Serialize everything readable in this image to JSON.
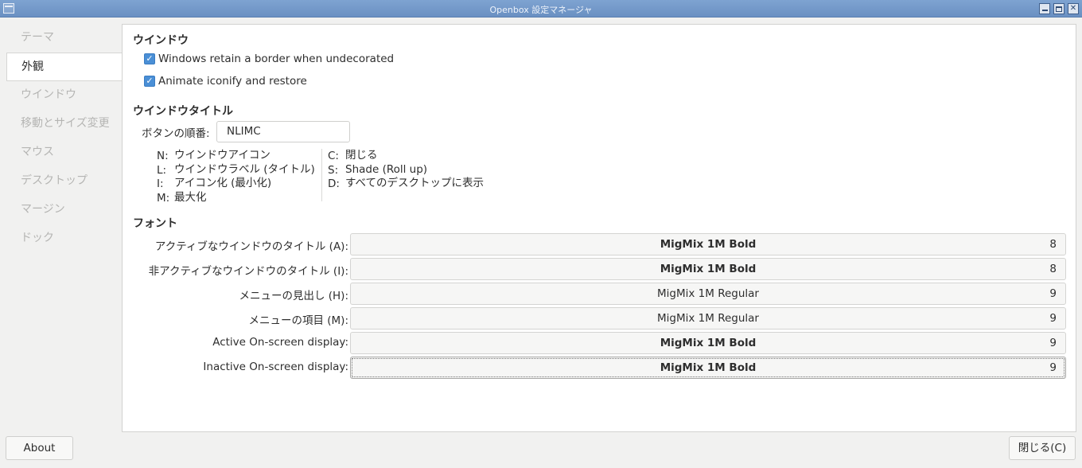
{
  "window": {
    "title": "Openbox 設定マネージャ"
  },
  "sidebar": {
    "items": [
      {
        "label": "テーマ",
        "active": false
      },
      {
        "label": "外観",
        "active": true
      },
      {
        "label": "ウインドウ",
        "active": false
      },
      {
        "label": "移動とサイズ変更",
        "active": false
      },
      {
        "label": "マウス",
        "active": false
      },
      {
        "label": "デスクトップ",
        "active": false
      },
      {
        "label": "マージン",
        "active": false
      },
      {
        "label": "ドック",
        "active": false
      }
    ]
  },
  "window_section": {
    "title": "ウインドウ",
    "options": [
      {
        "label": "Windows retain a border when undecorated",
        "checked": true
      },
      {
        "label": "Animate iconify and restore",
        "checked": true
      }
    ]
  },
  "titlebar_section": {
    "title": "ウインドウタイトル",
    "button_order_label": "ボタンの順番:",
    "button_order_value": "NLIMC",
    "legend_left": [
      {
        "key": "N:",
        "desc": "ウインドウアイコン"
      },
      {
        "key": "L:",
        "desc": "ウインドウラベル (タイトル)"
      },
      {
        "key": "I:",
        "desc": "アイコン化 (最小化)"
      },
      {
        "key": "M:",
        "desc": "最大化"
      }
    ],
    "legend_right": [
      {
        "key": "C:",
        "desc": "閉じる"
      },
      {
        "key": "S:",
        "desc": "Shade (Roll up)"
      },
      {
        "key": "D:",
        "desc": "すべてのデスクトップに表示"
      }
    ]
  },
  "font_section": {
    "title": "フォント",
    "rows": [
      {
        "label": "アクティブなウインドウのタイトル (A):",
        "font": "MigMix 1M Bold",
        "size": "8",
        "bold": true
      },
      {
        "label": "非アクティブなウインドウのタイトル (I):",
        "font": "MigMix 1M Bold",
        "size": "8",
        "bold": true
      },
      {
        "label": "メニューの見出し (H):",
        "font": "MigMix 1M Regular",
        "size": "9",
        "bold": false
      },
      {
        "label": "メニューの項目 (M):",
        "font": "MigMix 1M Regular",
        "size": "9",
        "bold": false
      },
      {
        "label": "Active On-screen display:",
        "font": "MigMix 1M Bold",
        "size": "9",
        "bold": true
      },
      {
        "label": "Inactive On-screen display:",
        "font": "MigMix 1M Bold",
        "size": "9",
        "bold": true
      }
    ]
  },
  "footer": {
    "about_label": "About",
    "close_label": "閉じる(C)"
  },
  "icons": {
    "app": "window-icon",
    "minimize": "minimize-icon",
    "maximize": "maximize-icon",
    "close": "close-icon",
    "checkbox": "checkmark-icon"
  },
  "colors": {
    "titlebar": "#6a90c2",
    "checkbox": "#4a8fd6"
  }
}
